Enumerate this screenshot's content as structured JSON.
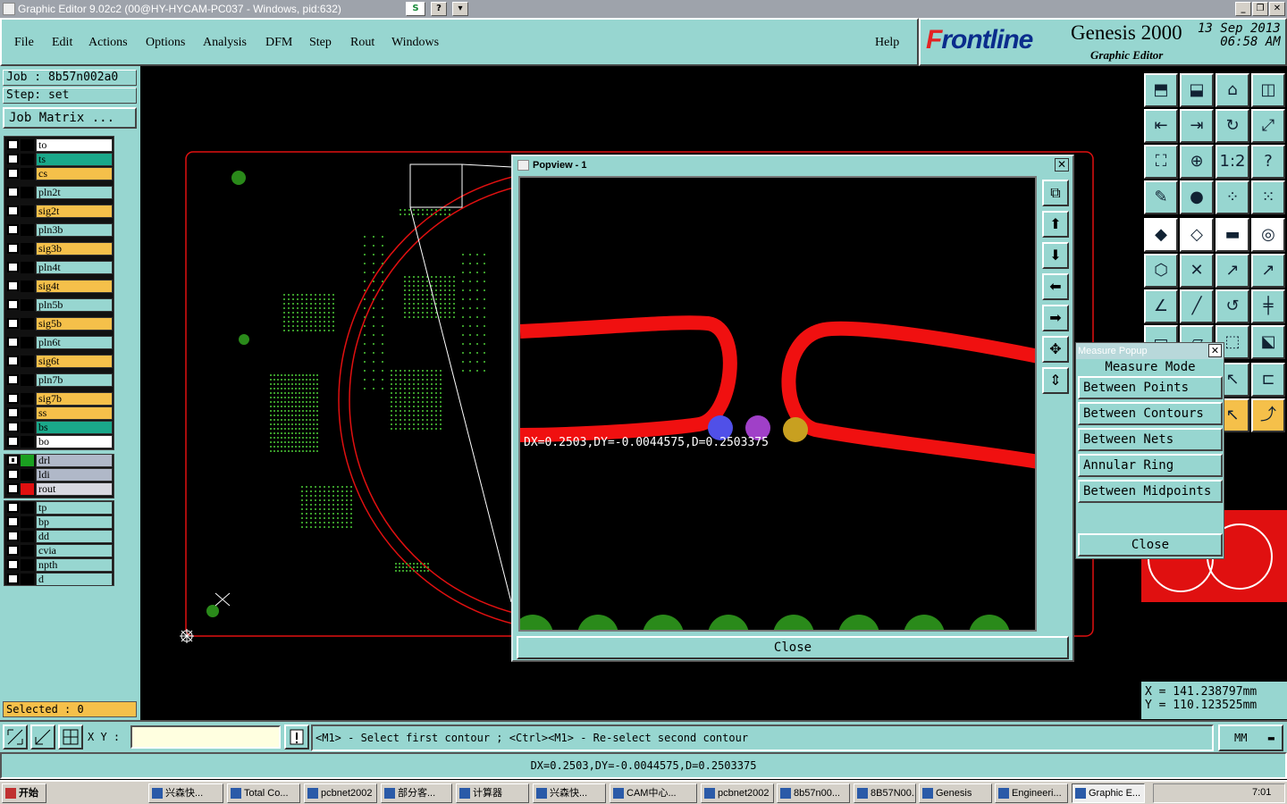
{
  "window": {
    "title": "Graphic Editor 9.02c2 (00@HY-HYCAM-PC037 - Windows, pid:632)"
  },
  "menu": [
    "File",
    "Edit",
    "Actions",
    "Options",
    "Analysis",
    "DFM",
    "Step",
    "Rout",
    "Windows"
  ],
  "help": "Help",
  "brand": {
    "logo_f": "F",
    "logo_rest": "rontline",
    "product": "Genesis 2000",
    "subtitle": "Graphic Editor",
    "date": "13 Sep 2013",
    "time": "06:58 AM"
  },
  "job": {
    "job_label": "Job : 8b57n002a0",
    "step_label": "Step: set",
    "matrix_button": "Job Matrix ..."
  },
  "layers": [
    {
      "name": "to",
      "color": "#ffffff"
    },
    {
      "name": "ts",
      "color": "#1aa88a"
    },
    {
      "name": "cs",
      "color": "#f5c04a"
    },
    {
      "name": "pln2t",
      "color": "#97d6d0"
    },
    {
      "name": "sig2t",
      "color": "#f5c04a"
    },
    {
      "name": "pln3b",
      "color": "#97d6d0"
    },
    {
      "name": "sig3b",
      "color": "#f5c04a"
    },
    {
      "name": "pln4t",
      "color": "#97d6d0"
    },
    {
      "name": "sig4t",
      "color": "#f5c04a"
    },
    {
      "name": "pln5b",
      "color": "#97d6d0"
    },
    {
      "name": "sig5b",
      "color": "#f5c04a"
    },
    {
      "name": "pln6t",
      "color": "#97d6d0"
    },
    {
      "name": "sig6t",
      "color": "#f5c04a"
    },
    {
      "name": "pln7b",
      "color": "#97d6d0"
    },
    {
      "name": "sig7b",
      "color": "#f5c04a"
    },
    {
      "name": "ss",
      "color": "#f5c04a"
    },
    {
      "name": "bs",
      "color": "#1aa88a"
    },
    {
      "name": "bo",
      "color": "#ffffff"
    },
    {
      "name": "drl",
      "color": "#b0b8c8"
    },
    {
      "name": "ldi",
      "color": "#b0b8c8"
    },
    {
      "name": "rout",
      "color": "#d8d8e0"
    },
    {
      "name": "tp",
      "color": "#97d6d0"
    },
    {
      "name": "bp",
      "color": "#97d6d0"
    },
    {
      "name": "dd",
      "color": "#97d6d0"
    },
    {
      "name": "cvia",
      "color": "#97d6d0"
    },
    {
      "name": "npth",
      "color": "#97d6d0"
    },
    {
      "name": "d",
      "color": "#97d6d0"
    }
  ],
  "selected": "Selected : 0",
  "popview": {
    "title": "Popview - 1",
    "measure_text": "DX=0.2503,DY=-0.0044575,D=0.2503375",
    "close": "Close"
  },
  "measure_popup": {
    "title": "Measure Popup",
    "mode_label": "Measure Mode",
    "items": [
      "Between Points",
      "Between Contours",
      "Between Nets",
      "Annular Ring",
      "Between Midpoints"
    ],
    "close": "Close"
  },
  "coords": {
    "x": "X  =  141.238797mm",
    "y": "Y  =  110.123525mm"
  },
  "bottom": {
    "xy_label": "X Y :",
    "prompt": "<M1> - Select first contour ; <Ctrl><M1> - Re-select second contour",
    "unit": "MM"
  },
  "status_line": "DX=0.2503,DY=-0.0044575,D=0.2503375",
  "taskbar": {
    "start": "开始",
    "items": [
      "兴森快...",
      "Total Co...",
      "pcbnet2002",
      "部分客...",
      "计算器",
      "兴森快...",
      "CAM中心...",
      "pcbnet2002",
      "8b57n00...",
      "8B57N00...",
      "Genesis",
      "Engineeri...",
      "Graphic E..."
    ],
    "clock": "7:01"
  }
}
